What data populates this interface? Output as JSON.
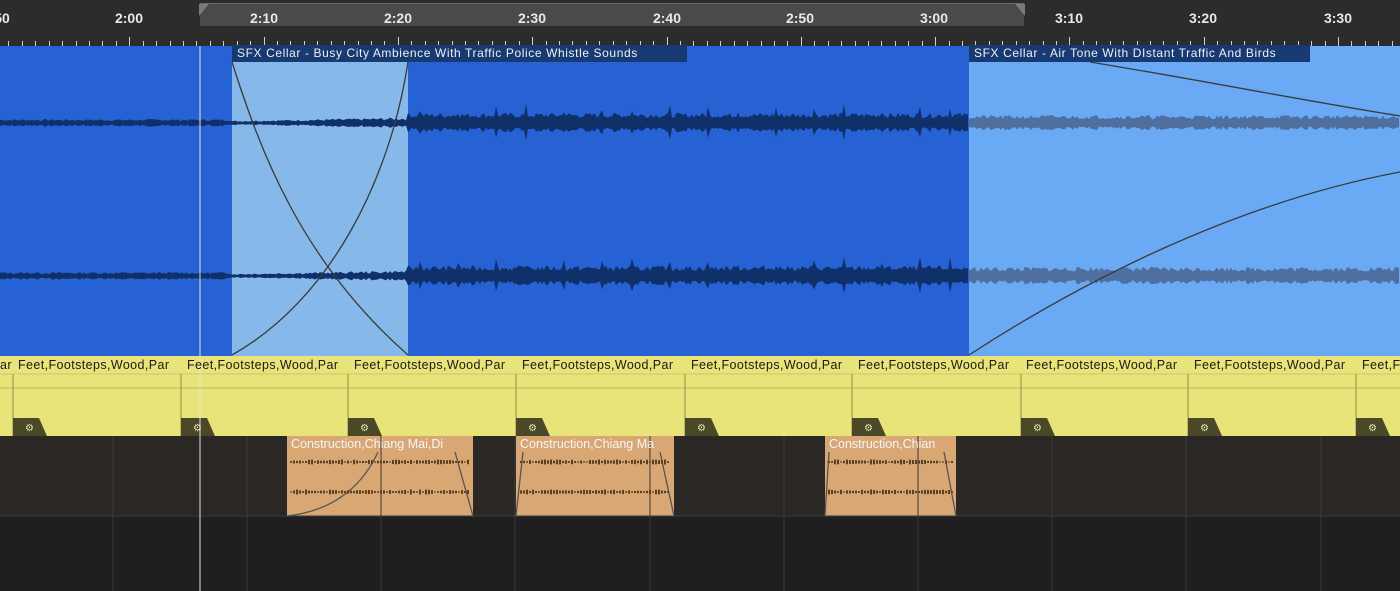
{
  "ruler": {
    "ticks": [
      {
        "label": "50"
      },
      {
        "label": "2:00"
      },
      {
        "label": "2:10"
      },
      {
        "label": "2:20"
      },
      {
        "label": "2:30"
      },
      {
        "label": "2:40"
      },
      {
        "label": "2:50"
      },
      {
        "label": "3:00"
      },
      {
        "label": "3:10"
      },
      {
        "label": "3:20"
      },
      {
        "label": "3:30"
      }
    ]
  },
  "tracks": {
    "ambience": {
      "clips": [
        {
          "name": "SFX Cellar - Busy City Ambience With Traffic Police Whistle Sounds"
        },
        {
          "name": "SFX Cellar - Air Tone With DIstant Traffic And Birds"
        }
      ]
    },
    "footsteps": {
      "clip_name": "Feet,Footsteps,Wood,Par",
      "clip_name_short": "ar"
    },
    "construction": {
      "clips": [
        {
          "name": "Construction,Chiang Mai,Di"
        },
        {
          "name": "Construction,Chiang Ma"
        },
        {
          "name": "Construction,Chian"
        }
      ]
    }
  },
  "colors": {
    "ambience_dark": "#2762d5",
    "ambience_light": "#6aaaf5",
    "ambience_selection": "#86b9ea",
    "footsteps": "#e8e47a",
    "construction": "#d9a774",
    "background": "#232323"
  }
}
